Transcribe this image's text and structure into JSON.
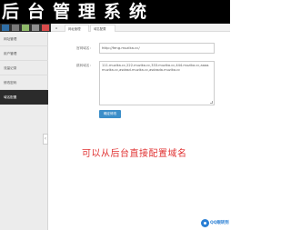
{
  "header": {
    "title": "后台管理系统"
  },
  "theme": {
    "swatches": [
      "#2f6ea6",
      "#7a7a7a",
      "#8fb96a",
      "#8e8e8e",
      "#d94b4b"
    ],
    "accent": "#3b8ec9",
    "annotation_color": "#e03333"
  },
  "sidebar": {
    "items": [
      {
        "label": "网址管理",
        "active": false
      },
      {
        "label": "用户管理",
        "active": false
      },
      {
        "label": "流量记录",
        "active": false
      },
      {
        "label": "修改密码",
        "active": false
      },
      {
        "label": "域名配置",
        "active": true
      }
    ]
  },
  "tabs": {
    "home_icon": "home-icon",
    "items": [
      {
        "label": "网址管理"
      },
      {
        "label": "域名配置"
      }
    ]
  },
  "form": {
    "url_label": "官网域名：",
    "url_value": "http://feng.muzika.cc/",
    "domains_label": "跳转域名：",
    "domains_value": "111.muzika.cc,222.muzika.cc,333.muzika.cc,444.muzika.cc,aaaa.muzika.cc,asdasd.muzika.cc,asdasda.muzika.cc",
    "submit_label": "确定修改"
  },
  "annotation": "可以从后台直接配置域名",
  "watermark": {
    "text": "QQ眼转到"
  }
}
